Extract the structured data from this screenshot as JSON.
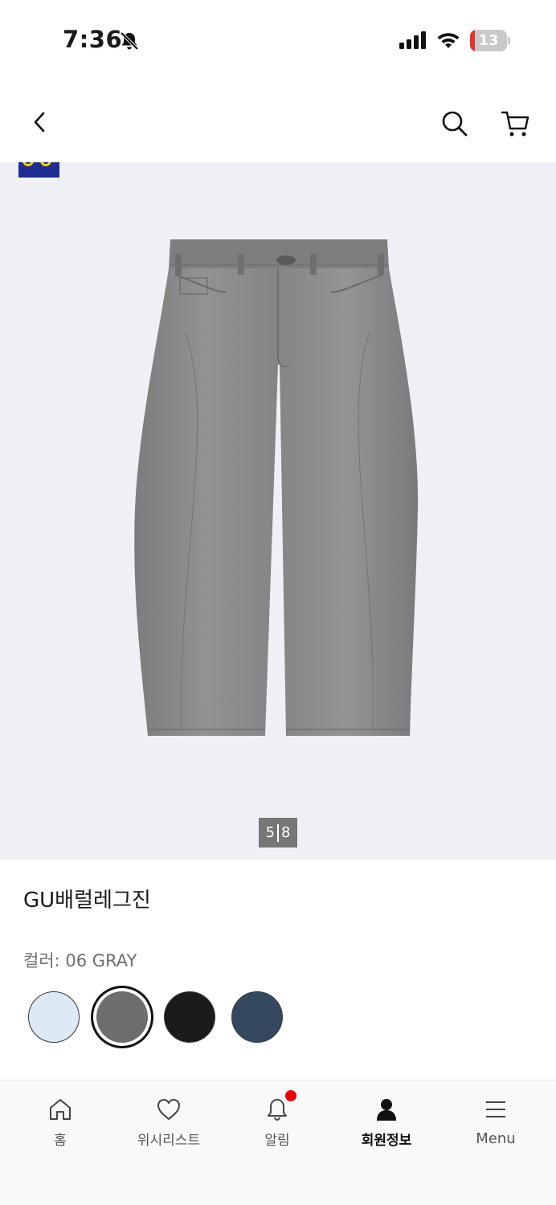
{
  "status_bar": {
    "time": "7:36",
    "battery_level": "13",
    "battery_fraction": 0.13
  },
  "header": {
    "back_icon": "chevron-left-icon",
    "search_icon": "search-icon",
    "cart_icon": "cart-icon"
  },
  "gallery": {
    "brand_logo": "GU",
    "current_page": "5",
    "total_pages": "8",
    "background": "#eff0f5"
  },
  "product": {
    "name": "GU배럴레그진",
    "color_label": "컬러: 06 GRAY",
    "swatches": [
      {
        "name": "light blue",
        "color": "#dde9f4",
        "selected": false
      },
      {
        "name": "gray",
        "color": "#6e6c6d",
        "selected": true
      },
      {
        "name": "black",
        "color": "#1b1b1b",
        "selected": false
      },
      {
        "name": "navy",
        "color": "#34495f",
        "selected": false
      }
    ]
  },
  "bottom_nav": {
    "items": [
      {
        "label": "홈",
        "icon": "home-icon",
        "active": false
      },
      {
        "label": "위시리스트",
        "icon": "heart-icon",
        "active": false
      },
      {
        "label": "알림",
        "icon": "bell-icon",
        "active": false,
        "has_badge": true
      },
      {
        "label": "회원정보",
        "icon": "person-icon",
        "active": true
      },
      {
        "label": "Menu",
        "icon": "menu-icon",
        "active": false
      }
    ]
  }
}
